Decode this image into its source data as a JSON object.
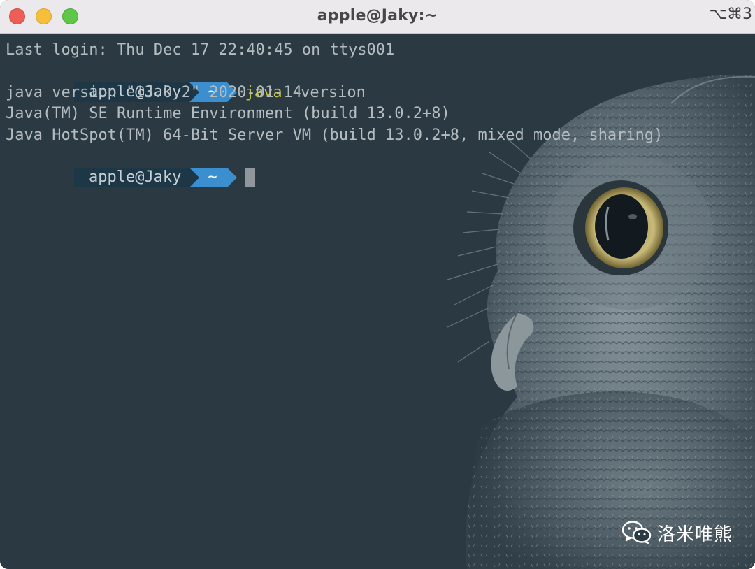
{
  "window": {
    "title": "apple@Jaky:~",
    "shortcut": "⌥⌘3",
    "traffic_lights": [
      "close",
      "minimize",
      "zoom"
    ]
  },
  "terminal": {
    "last_login": "Last login: Thu Dec 17 22:40:45 on ttys001",
    "prompt1": {
      "user": "apple@Jaky",
      "dir": "~",
      "command": "java",
      "argument": " -version"
    },
    "output": [
      "java version \"13.0.2\" 2020-01-14",
      "Java(TM) SE Runtime Environment (build 13.0.2+8)",
      "Java HotSpot(TM) 64-Bit Server VM (build 13.0.2+8, mixed mode, sharing)"
    ],
    "prompt2": {
      "user": "apple@Jaky",
      "dir": "~"
    },
    "background_image": "owl"
  },
  "watermark": {
    "icon": "wechat-icon",
    "text": "洛米唯熊"
  },
  "colors": {
    "terminal_bg": "#2b3a42",
    "prompt_user_bg": "#1e3746",
    "prompt_dir_bg": "#3c8fcf",
    "command_color": "#c3c43e"
  }
}
